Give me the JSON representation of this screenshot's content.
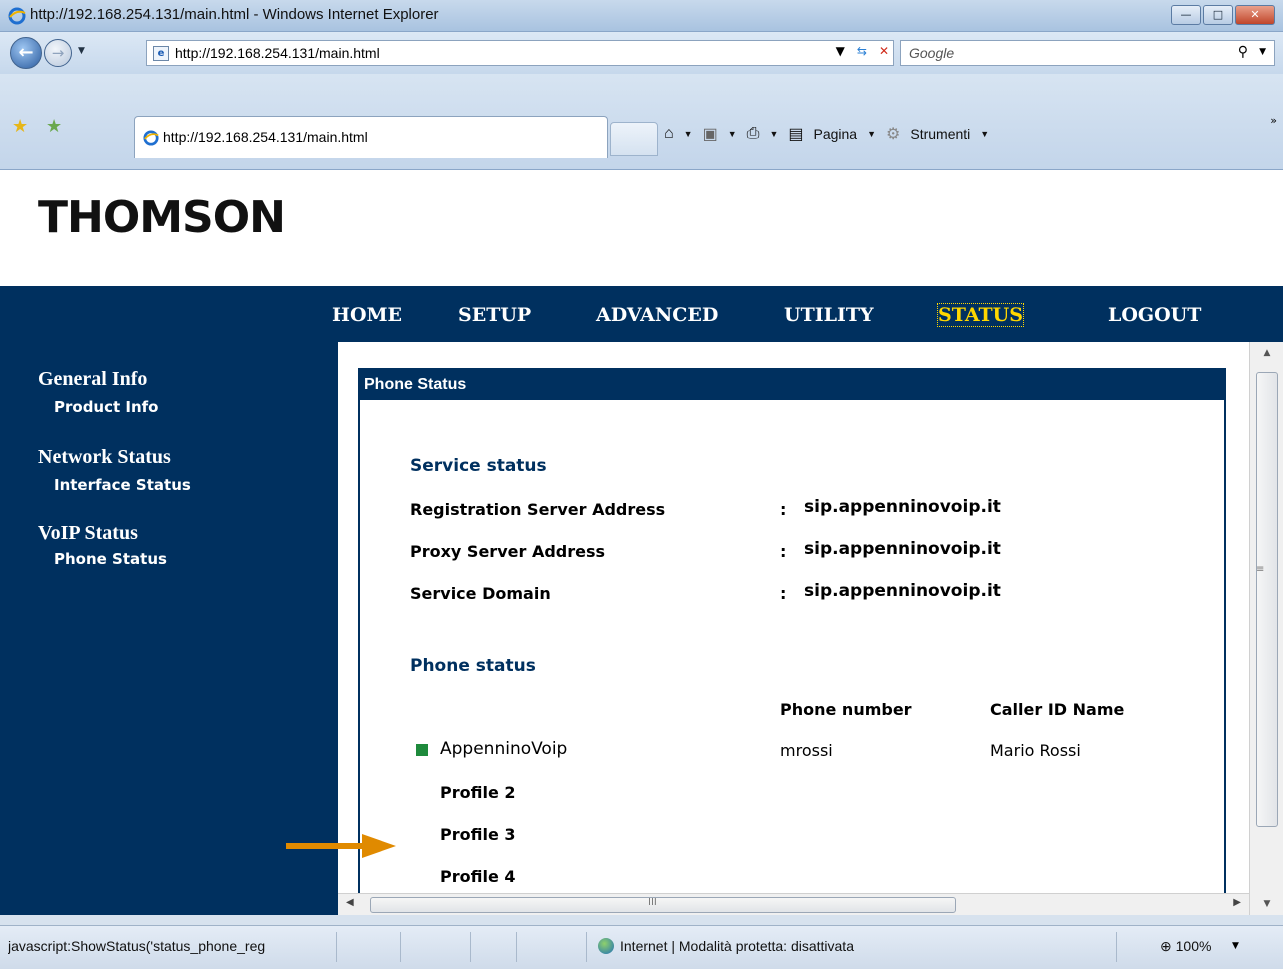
{
  "window": {
    "title": "http://192.168.254.131/main.html - Windows Internet Explorer",
    "url": "http://192.168.254.131/main.html",
    "search_placeholder": "Google",
    "tab_label": "http://192.168.254.131/main.html",
    "commands": {
      "page": "Pagina",
      "tools": "Strumenti"
    }
  },
  "page": {
    "logo": "THOMSON",
    "nav": [
      "HOME",
      "SETUP",
      "ADVANCED",
      "UTILITY",
      "STATUS",
      "LOGOUT"
    ],
    "active_nav": "STATUS",
    "sidebar": {
      "general": "General Info",
      "product": "Product Info",
      "network": "Network Status",
      "interface": "Interface Status",
      "voip": "VoIP Status",
      "phone": "Phone Status"
    },
    "panel_title": "Phone Status",
    "service_heading": "Service status",
    "service_rows": [
      {
        "label": "Registration Server Address",
        "value": "sip.appenninovoip.it"
      },
      {
        "label": "Proxy Server Address",
        "value": "sip.appenninovoip.it"
      },
      {
        "label": "Service Domain",
        "value": "sip.appenninovoip.it"
      }
    ],
    "colon": ":",
    "phone_heading": "Phone status",
    "columns": {
      "number": "Phone number",
      "caller": "Caller ID Name"
    },
    "profiles": [
      {
        "name": "AppenninoVoip",
        "number": "mrossi",
        "caller": "Mario Rossi"
      },
      {
        "name": "Profile 2"
      },
      {
        "name": "Profile 3"
      },
      {
        "name": "Profile 4"
      }
    ],
    "registered_color": "#1e8a3c",
    "arrow_color": "#e08a00"
  },
  "statusbar": {
    "message": "javascript:ShowStatus('status_phone_reg",
    "zone": "Internet | Modalità protetta: disattivata",
    "zoom": "100%"
  }
}
